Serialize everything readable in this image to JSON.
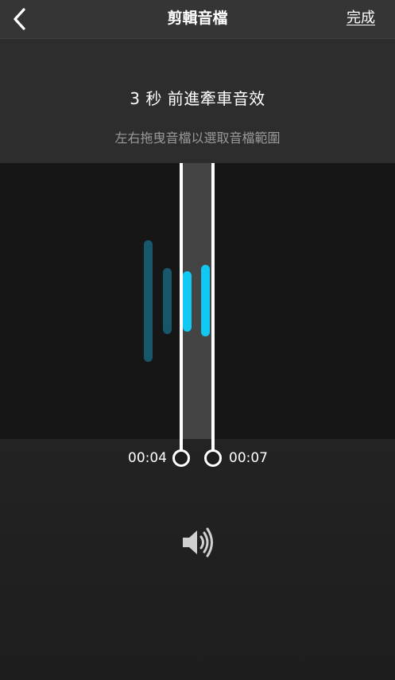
{
  "navbar": {
    "back_icon": "chevron-left-icon",
    "title": "剪輯音檔",
    "done_label": "完成"
  },
  "info": {
    "clip_name": "3 秒 前進牽車音效",
    "hint": "左右拖曳音檔以選取音檔範圍"
  },
  "trim": {
    "start_time": "00:04",
    "end_time": "00:07"
  },
  "colors": {
    "waveform_active": "#11c8f2",
    "waveform_inactive": "#16586a"
  },
  "player": {
    "speaker_icon": "speaker-volume-icon"
  }
}
